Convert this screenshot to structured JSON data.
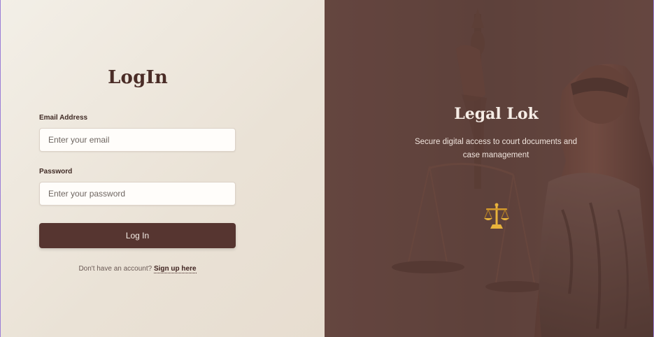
{
  "login": {
    "title": "LogIn",
    "email_label": "Email Address",
    "email_placeholder": "Enter your email",
    "email_value": "",
    "password_label": "Password",
    "password_placeholder": "Enter your password",
    "password_value": "",
    "submit_label": "Log In",
    "signup_prompt": "Don't have an account?",
    "signup_link": "Sign up here"
  },
  "hero": {
    "brand": "Legal Lok",
    "tagline": "Secure digital access to court documents and case management",
    "icon": "balance-scale-icon"
  },
  "colors": {
    "primary": "#563530",
    "panel_bg": "#5f423c",
    "accent_gold": "#e8b33c",
    "left_bg": "#efe9df"
  }
}
